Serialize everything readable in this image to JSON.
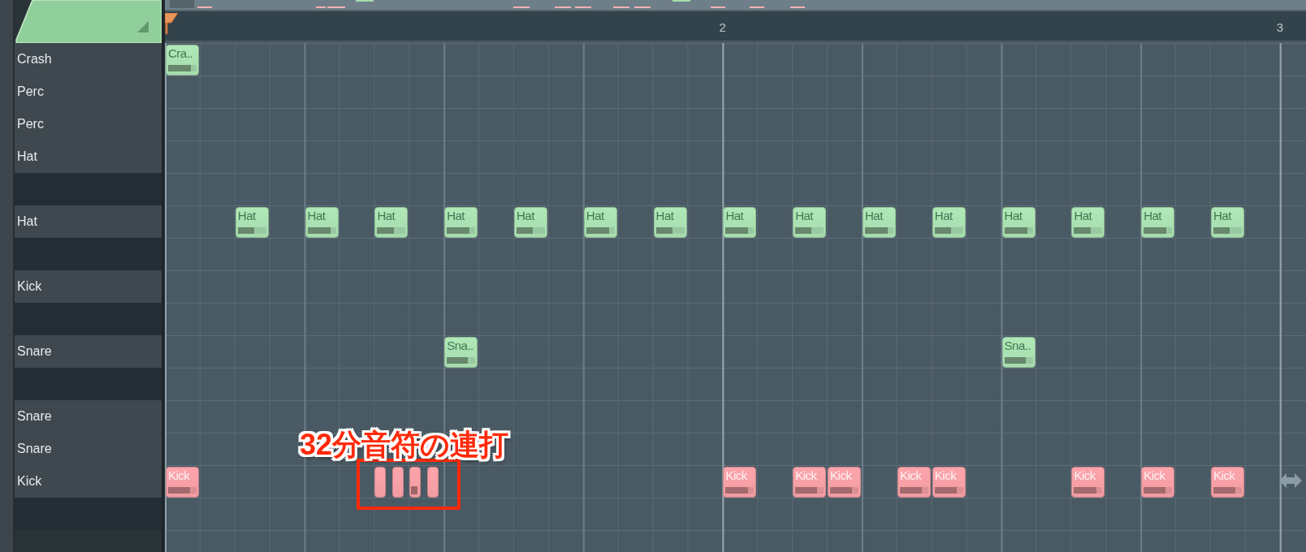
{
  "ruler": {
    "bar_labels": [
      "2",
      "3"
    ]
  },
  "rows": [
    {
      "kind": "key",
      "label": "Crash",
      "cells": [
        {
          "kind": "note",
          "text": "Cra..",
          "color": "#a6dbae",
          "level": 0.8
        }
      ]
    },
    {
      "kind": "key",
      "label": "Perc"
    },
    {
      "kind": "key",
      "label": "Perc"
    },
    {
      "kind": "key",
      "label": "Hat"
    },
    {
      "kind": "blank"
    },
    {
      "kind": "key",
      "label": "Hat",
      "cells": [
        {
          "kind": "rest"
        },
        {
          "kind": "rest"
        },
        {
          "kind": "note",
          "text": "Hat",
          "color": "#a6dbae",
          "level": 0.58
        },
        {
          "kind": "rest"
        },
        {
          "kind": "note",
          "text": "Hat",
          "color": "#a6dbae",
          "level": 0.8
        },
        {
          "kind": "rest"
        },
        {
          "kind": "note",
          "text": "Hat",
          "color": "#a6dbae",
          "level": 0.58
        },
        {
          "kind": "rest"
        },
        {
          "kind": "note",
          "text": "Hat",
          "color": "#a6dbae",
          "level": 0.8
        },
        {
          "kind": "rest"
        },
        {
          "kind": "note",
          "text": "Hat",
          "color": "#a6dbae",
          "level": 0.58
        },
        {
          "kind": "rest"
        },
        {
          "kind": "note",
          "text": "Hat",
          "color": "#a6dbae",
          "level": 0.8
        },
        {
          "kind": "rest"
        },
        {
          "kind": "note",
          "text": "Hat",
          "color": "#a6dbae",
          "level": 0.58
        },
        {
          "kind": "rest"
        },
        {
          "kind": "note",
          "text": "Hat",
          "color": "#a6dbae",
          "level": 0.8
        },
        {
          "kind": "rest"
        },
        {
          "kind": "note",
          "text": "Hat",
          "color": "#a6dbae",
          "level": 0.58
        },
        {
          "kind": "rest"
        },
        {
          "kind": "note",
          "text": "Hat",
          "color": "#a6dbae",
          "level": 0.8
        },
        {
          "kind": "rest"
        },
        {
          "kind": "note",
          "text": "Hat",
          "color": "#a6dbae",
          "level": 0.58
        },
        {
          "kind": "rest"
        },
        {
          "kind": "note",
          "text": "Hat",
          "color": "#a6dbae",
          "level": 0.8
        },
        {
          "kind": "rest"
        },
        {
          "kind": "note",
          "text": "Hat",
          "color": "#a6dbae",
          "level": 0.58
        },
        {
          "kind": "rest"
        },
        {
          "kind": "note",
          "text": "Hat",
          "color": "#a6dbae",
          "level": 0.8
        },
        {
          "kind": "rest"
        },
        {
          "kind": "note",
          "text": "Hat",
          "color": "#a6dbae",
          "level": 0.58
        }
      ]
    },
    {
      "kind": "blank"
    },
    {
      "kind": "key",
      "label": "Kick"
    },
    {
      "kind": "blank"
    },
    {
      "kind": "key",
      "label": "Snare",
      "cells": [
        {
          "kind": "rest"
        },
        {
          "kind": "rest"
        },
        {
          "kind": "rest"
        },
        {
          "kind": "rest"
        },
        {
          "kind": "rest"
        },
        {
          "kind": "rest"
        },
        {
          "kind": "rest"
        },
        {
          "kind": "rest"
        },
        {
          "kind": "note",
          "text": "Sna..",
          "color": "#a6dbae",
          "level": 0.75
        },
        {
          "kind": "rest"
        },
        {
          "kind": "rest"
        },
        {
          "kind": "rest"
        },
        {
          "kind": "rest"
        },
        {
          "kind": "rest"
        },
        {
          "kind": "rest"
        },
        {
          "kind": "rest"
        },
        {
          "kind": "rest"
        },
        {
          "kind": "rest"
        },
        {
          "kind": "rest"
        },
        {
          "kind": "rest"
        },
        {
          "kind": "rest"
        },
        {
          "kind": "rest"
        },
        {
          "kind": "rest"
        },
        {
          "kind": "rest"
        },
        {
          "kind": "note",
          "text": "Sna..",
          "color": "#a6dbae",
          "level": 0.75
        }
      ]
    },
    {
      "kind": "blank"
    },
    {
      "kind": "key",
      "label": "Snare"
    },
    {
      "kind": "key",
      "label": "Snare"
    },
    {
      "kind": "key",
      "label": "Kick",
      "cells": [
        {
          "kind": "note",
          "text": "Kick",
          "color": "#f09ca2",
          "level": 0.78
        },
        {
          "kind": "rest"
        },
        {
          "kind": "rest"
        },
        {
          "kind": "rest"
        },
        {
          "kind": "rest"
        },
        {
          "kind": "rest"
        },
        {
          "kind": "split",
          "notes": [
            {
              "color": "#f09ca2",
              "velocity_mark": false
            },
            {
              "color": "#f09ca2",
              "velocity_mark": false
            }
          ]
        },
        {
          "kind": "split",
          "notes": [
            {
              "color": "#f09ca2",
              "velocity_mark": true
            },
            {
              "color": "#f09ca2",
              "velocity_mark": false
            }
          ]
        },
        {
          "kind": "rest"
        },
        {
          "kind": "rest"
        },
        {
          "kind": "rest"
        },
        {
          "kind": "rest"
        },
        {
          "kind": "rest"
        },
        {
          "kind": "rest"
        },
        {
          "kind": "rest"
        },
        {
          "kind": "rest"
        },
        {
          "kind": "note",
          "text": "Kick",
          "color": "#f09ca2",
          "level": 0.78
        },
        {
          "kind": "rest"
        },
        {
          "kind": "note",
          "text": "Kick",
          "color": "#f09ca2",
          "level": 0.78
        },
        {
          "kind": "note",
          "text": "Kick",
          "color": "#f09ca2",
          "level": 0.78
        },
        {
          "kind": "rest"
        },
        {
          "kind": "note",
          "text": "Kick",
          "color": "#f09ca2",
          "level": 0.78
        },
        {
          "kind": "note",
          "text": "Kick",
          "color": "#f09ca2",
          "level": 0.78
        },
        {
          "kind": "rest"
        },
        {
          "kind": "rest"
        },
        {
          "kind": "rest"
        },
        {
          "kind": "note",
          "text": "Kick",
          "color": "#f09ca2",
          "level": 0.78
        },
        {
          "kind": "rest"
        },
        {
          "kind": "note",
          "text": "Kick",
          "color": "#f09ca2",
          "level": 0.78
        },
        {
          "kind": "rest"
        },
        {
          "kind": "note",
          "text": "Kick",
          "color": "#f09ca2",
          "level": 0.78
        }
      ]
    },
    {
      "kind": "blank"
    }
  ],
  "annotation": {
    "text": "32分音符の連打"
  }
}
